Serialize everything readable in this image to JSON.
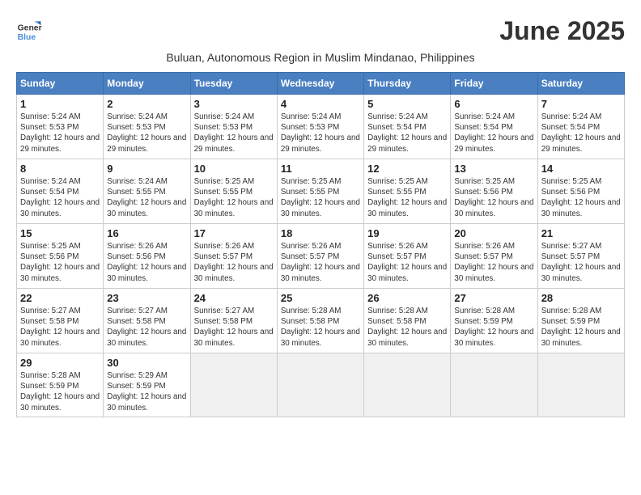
{
  "logo": {
    "line1": "General",
    "line2": "Blue"
  },
  "title": "June 2025",
  "subtitle": "Buluan, Autonomous Region in Muslim Mindanao, Philippines",
  "days_of_week": [
    "Sunday",
    "Monday",
    "Tuesday",
    "Wednesday",
    "Thursday",
    "Friday",
    "Saturday"
  ],
  "weeks": [
    [
      {
        "day": 1,
        "sunrise": "5:24 AM",
        "sunset": "5:53 PM",
        "daylight": "12 hours and 29 minutes."
      },
      {
        "day": 2,
        "sunrise": "5:24 AM",
        "sunset": "5:53 PM",
        "daylight": "12 hours and 29 minutes."
      },
      {
        "day": 3,
        "sunrise": "5:24 AM",
        "sunset": "5:53 PM",
        "daylight": "12 hours and 29 minutes."
      },
      {
        "day": 4,
        "sunrise": "5:24 AM",
        "sunset": "5:53 PM",
        "daylight": "12 hours and 29 minutes."
      },
      {
        "day": 5,
        "sunrise": "5:24 AM",
        "sunset": "5:54 PM",
        "daylight": "12 hours and 29 minutes."
      },
      {
        "day": 6,
        "sunrise": "5:24 AM",
        "sunset": "5:54 PM",
        "daylight": "12 hours and 29 minutes."
      },
      {
        "day": 7,
        "sunrise": "5:24 AM",
        "sunset": "5:54 PM",
        "daylight": "12 hours and 29 minutes."
      }
    ],
    [
      {
        "day": 8,
        "sunrise": "5:24 AM",
        "sunset": "5:54 PM",
        "daylight": "12 hours and 30 minutes."
      },
      {
        "day": 9,
        "sunrise": "5:24 AM",
        "sunset": "5:55 PM",
        "daylight": "12 hours and 30 minutes."
      },
      {
        "day": 10,
        "sunrise": "5:25 AM",
        "sunset": "5:55 PM",
        "daylight": "12 hours and 30 minutes."
      },
      {
        "day": 11,
        "sunrise": "5:25 AM",
        "sunset": "5:55 PM",
        "daylight": "12 hours and 30 minutes."
      },
      {
        "day": 12,
        "sunrise": "5:25 AM",
        "sunset": "5:55 PM",
        "daylight": "12 hours and 30 minutes."
      },
      {
        "day": 13,
        "sunrise": "5:25 AM",
        "sunset": "5:56 PM",
        "daylight": "12 hours and 30 minutes."
      },
      {
        "day": 14,
        "sunrise": "5:25 AM",
        "sunset": "5:56 PM",
        "daylight": "12 hours and 30 minutes."
      }
    ],
    [
      {
        "day": 15,
        "sunrise": "5:25 AM",
        "sunset": "5:56 PM",
        "daylight": "12 hours and 30 minutes."
      },
      {
        "day": 16,
        "sunrise": "5:26 AM",
        "sunset": "5:56 PM",
        "daylight": "12 hours and 30 minutes."
      },
      {
        "day": 17,
        "sunrise": "5:26 AM",
        "sunset": "5:57 PM",
        "daylight": "12 hours and 30 minutes."
      },
      {
        "day": 18,
        "sunrise": "5:26 AM",
        "sunset": "5:57 PM",
        "daylight": "12 hours and 30 minutes."
      },
      {
        "day": 19,
        "sunrise": "5:26 AM",
        "sunset": "5:57 PM",
        "daylight": "12 hours and 30 minutes."
      },
      {
        "day": 20,
        "sunrise": "5:26 AM",
        "sunset": "5:57 PM",
        "daylight": "12 hours and 30 minutes."
      },
      {
        "day": 21,
        "sunrise": "5:27 AM",
        "sunset": "5:57 PM",
        "daylight": "12 hours and 30 minutes."
      }
    ],
    [
      {
        "day": 22,
        "sunrise": "5:27 AM",
        "sunset": "5:58 PM",
        "daylight": "12 hours and 30 minutes."
      },
      {
        "day": 23,
        "sunrise": "5:27 AM",
        "sunset": "5:58 PM",
        "daylight": "12 hours and 30 minutes."
      },
      {
        "day": 24,
        "sunrise": "5:27 AM",
        "sunset": "5:58 PM",
        "daylight": "12 hours and 30 minutes."
      },
      {
        "day": 25,
        "sunrise": "5:28 AM",
        "sunset": "5:58 PM",
        "daylight": "12 hours and 30 minutes."
      },
      {
        "day": 26,
        "sunrise": "5:28 AM",
        "sunset": "5:58 PM",
        "daylight": "12 hours and 30 minutes."
      },
      {
        "day": 27,
        "sunrise": "5:28 AM",
        "sunset": "5:59 PM",
        "daylight": "12 hours and 30 minutes."
      },
      {
        "day": 28,
        "sunrise": "5:28 AM",
        "sunset": "5:59 PM",
        "daylight": "12 hours and 30 minutes."
      }
    ],
    [
      {
        "day": 29,
        "sunrise": "5:28 AM",
        "sunset": "5:59 PM",
        "daylight": "12 hours and 30 minutes."
      },
      {
        "day": 30,
        "sunrise": "5:29 AM",
        "sunset": "5:59 PM",
        "daylight": "12 hours and 30 minutes."
      },
      null,
      null,
      null,
      null,
      null
    ]
  ]
}
